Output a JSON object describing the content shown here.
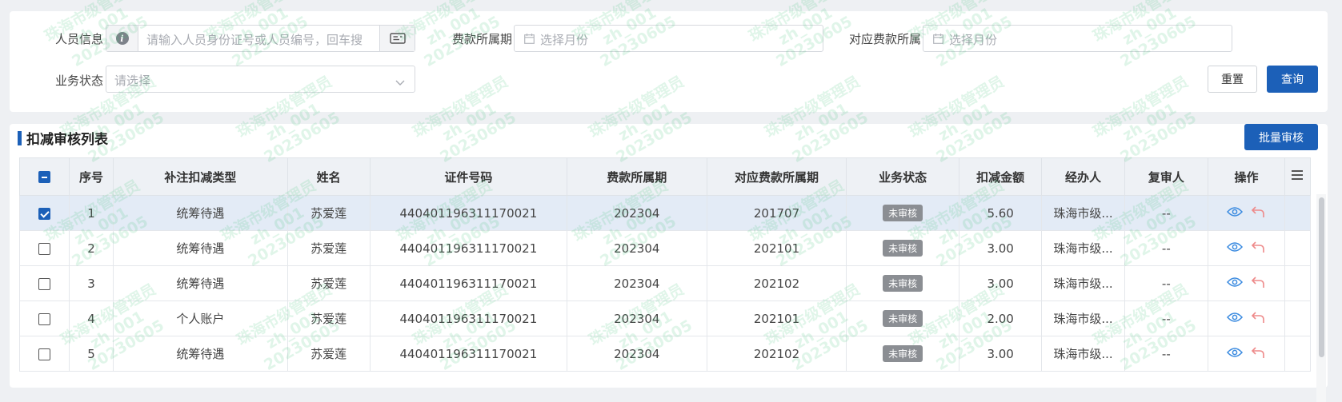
{
  "filters": {
    "person_label": "人员信息",
    "person_placeholder": "请输入人员身份证号或人员编号，回车搜",
    "period_label": "费款所属期",
    "period_placeholder": "选择月份",
    "corr_period_label": "对应费款所属",
    "corr_period_placeholder": "选择月份",
    "status_label": "业务状态",
    "status_placeholder": "请选择",
    "reset_label": "重置",
    "query_label": "查询"
  },
  "list": {
    "title": "扣减审核列表",
    "batch_label": "批量审核",
    "columns": [
      "序号",
      "补注扣减类型",
      "姓名",
      "证件号码",
      "费款所属期",
      "对应费款所属期",
      "业务状态",
      "扣减金额",
      "经办人",
      "复审人",
      "操作"
    ],
    "rows": [
      {
        "no": "1",
        "type": "统筹待遇",
        "name": "苏爱莲",
        "id": "440401196311170021",
        "period": "202304",
        "corr": "201707",
        "status": "未审核",
        "amount": "5.60",
        "handler": "珠海市级...",
        "reviewer": "--",
        "checked": true
      },
      {
        "no": "2",
        "type": "统筹待遇",
        "name": "苏爱莲",
        "id": "440401196311170021",
        "period": "202304",
        "corr": "202101",
        "status": "未审核",
        "amount": "3.00",
        "handler": "珠海市级...",
        "reviewer": "--",
        "checked": false
      },
      {
        "no": "3",
        "type": "统筹待遇",
        "name": "苏爱莲",
        "id": "440401196311170021",
        "period": "202304",
        "corr": "202102",
        "status": "未审核",
        "amount": "3.00",
        "handler": "珠海市级...",
        "reviewer": "--",
        "checked": false
      },
      {
        "no": "4",
        "type": "个人账户",
        "name": "苏爱莲",
        "id": "440401196311170021",
        "period": "202304",
        "corr": "202101",
        "status": "未审核",
        "amount": "2.00",
        "handler": "珠海市级...",
        "reviewer": "--",
        "checked": false
      },
      {
        "no": "5",
        "type": "统筹待遇",
        "name": "苏爱莲",
        "id": "440401196311170021",
        "period": "202304",
        "corr": "202102",
        "status": "未审核",
        "amount": "3.00",
        "handler": "珠海市级...",
        "reviewer": "--",
        "checked": false
      }
    ]
  },
  "watermark": {
    "line1": "珠海市级管理员",
    "line2": "zh_001",
    "line3": "20230605"
  },
  "colors": {
    "primary": "#1c60b8",
    "amount": "#3b8be0",
    "view_icon": "#3b8be0",
    "return_icon": "#ee8a8a"
  }
}
